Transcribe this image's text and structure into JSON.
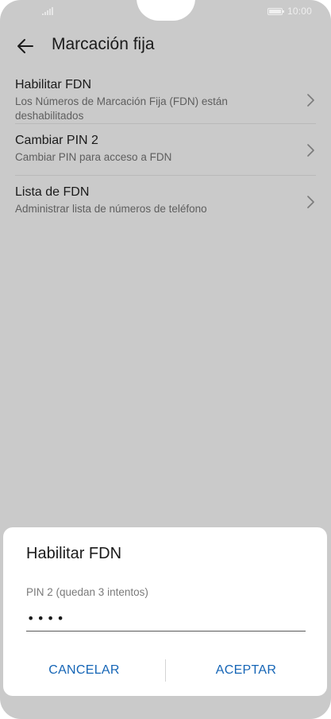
{
  "status_bar": {
    "time": "10:00",
    "icons": [
      "signal-icon",
      "battery-icon"
    ]
  },
  "app_bar": {
    "back_icon": "arrow-left-icon",
    "title": "Marcación fija"
  },
  "list": {
    "items": [
      {
        "title": "Habilitar FDN",
        "subtitle": "Los Números de Marcación Fija (FDN) están deshabilitados",
        "icon": "chevron-right-icon"
      },
      {
        "title": "Cambiar PIN 2",
        "subtitle": "Cambiar PIN para acceso a FDN",
        "icon": "chevron-right-icon"
      },
      {
        "title": "Lista de FDN",
        "subtitle": "Administrar lista de números de teléfono",
        "icon": "chevron-right-icon"
      }
    ]
  },
  "dialog": {
    "title": "Habilitar FDN",
    "field_label": "PIN 2 (quedan 3 intentos)",
    "pin_value": "1234",
    "cancel_label": "CANCELAR",
    "ok_label": "ACEPTAR"
  },
  "colors": {
    "accent": "#1565b6",
    "scrim_background": "#cacaca",
    "dialog_background": "#ffffff"
  }
}
